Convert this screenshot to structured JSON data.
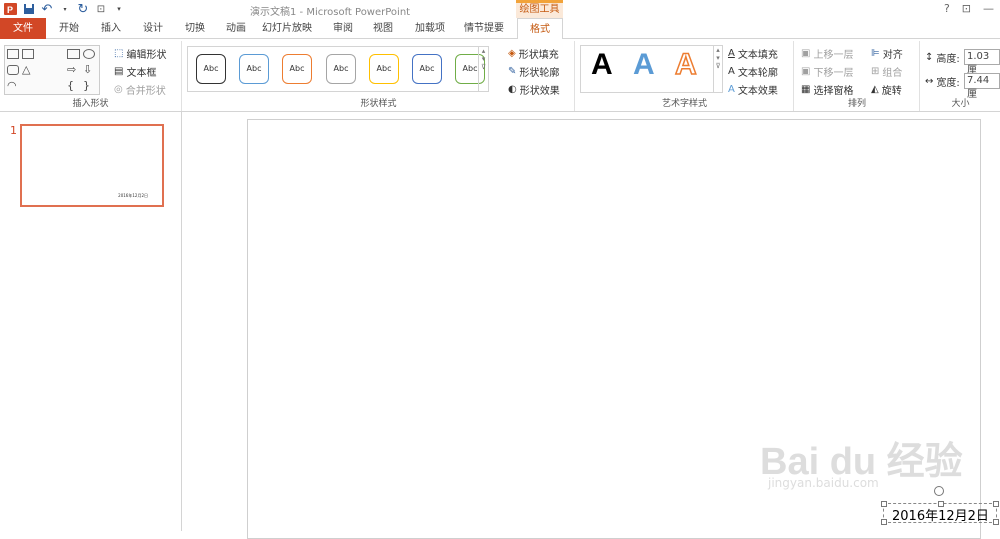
{
  "window": {
    "title": "演示文稿1 - Microsoft PowerPoint",
    "context_tool": "绘图工具",
    "help": "?"
  },
  "tabs": [
    {
      "label": "文件"
    },
    {
      "label": "开始"
    },
    {
      "label": "插入"
    },
    {
      "label": "设计"
    },
    {
      "label": "切换"
    },
    {
      "label": "动画"
    },
    {
      "label": "幻灯片放映"
    },
    {
      "label": "审阅"
    },
    {
      "label": "视图"
    },
    {
      "label": "加载项"
    },
    {
      "label": "情节提要"
    },
    {
      "label": "格式"
    }
  ],
  "ribbon": {
    "insert_shapes": {
      "label": "插入形状",
      "edit_shape": "编辑形状",
      "textbox": "文本框",
      "merge": "合并形状"
    },
    "shape_styles": {
      "label": "形状样式",
      "abc": "Abc",
      "fill": "形状填充",
      "outline": "形状轮廓",
      "effects": "形状效果"
    },
    "wordart": {
      "label": "艺术字样式",
      "a": "A",
      "text_fill": "文本填充",
      "text_outline": "文本轮廓",
      "text_effects": "文本效果"
    },
    "arrange": {
      "label": "排列",
      "bring_forward": "上移一层",
      "send_backward": "下移一层",
      "selection_pane": "选择窗格",
      "align": "对齐",
      "group": "组合",
      "rotate": "旋转"
    },
    "size": {
      "label": "大小",
      "height_label": "高度:",
      "height_value": "1.03 厘",
      "width_label": "宽度:",
      "width_value": "7.44 厘"
    }
  },
  "thumbs": {
    "num": "1"
  },
  "slide": {
    "date_text": "2016年12月2日"
  },
  "watermark": {
    "main": "Bai du 经验",
    "sub": "jingyan.baidu.com"
  },
  "colors": {
    "file_tab": "#d24726",
    "accent": "#c55a11"
  }
}
